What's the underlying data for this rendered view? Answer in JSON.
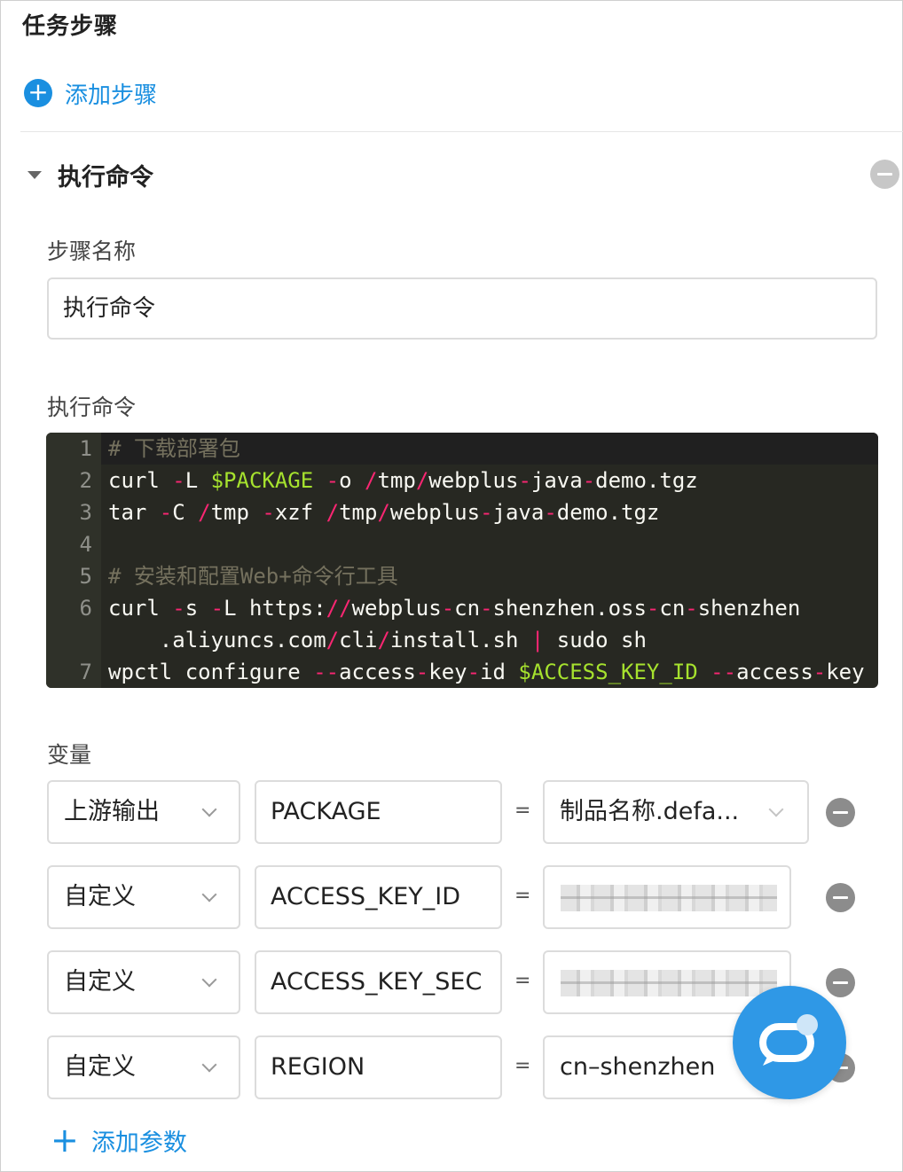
{
  "section": {
    "title": "任务步骤",
    "add_step_label": "添加步骤"
  },
  "step": {
    "title": "执行命令",
    "name_label": "步骤名称",
    "name_value": "执行命令",
    "command_label": "执行命令"
  },
  "editor": {
    "line_numbers": [
      "1",
      "2",
      "3",
      "4",
      "5",
      "6",
      "",
      "7"
    ],
    "lines": [
      "# 下载部署包",
      "curl -L $PACKAGE -o /tmp/webplus-java-demo.tgz",
      "tar -C /tmp -xzf /tmp/webplus-java-demo.tgz",
      "",
      "# 安装和配置Web+命令行工具",
      "curl -s -L https://webplus-cn-shenzhen.oss-cn-shenzhen",
      "    .aliyuncs.com/cli/install.sh | sudo sh",
      "wpctl configure --access-key-id $ACCESS_KEY_ID --access-key"
    ]
  },
  "variables": {
    "label": "变量",
    "eq": "=",
    "rows": [
      {
        "source": "上游输出",
        "name": "PACKAGE",
        "value": "制品名称.defa..."
      },
      {
        "source": "自定义",
        "name": "ACCESS_KEY_ID",
        "value": ""
      },
      {
        "source": "自定义",
        "name": "ACCESS_KEY_SEC",
        "value": ""
      },
      {
        "source": "自定义",
        "name": "REGION",
        "value": "cn–shenzhen"
      }
    ],
    "add_label": "添加参数"
  },
  "colors": {
    "accent": "#1a8fe0",
    "editor_bg": "#272822",
    "code_var": "#a6e22e",
    "code_op": "#f92672",
    "code_comment": "#75715e"
  }
}
